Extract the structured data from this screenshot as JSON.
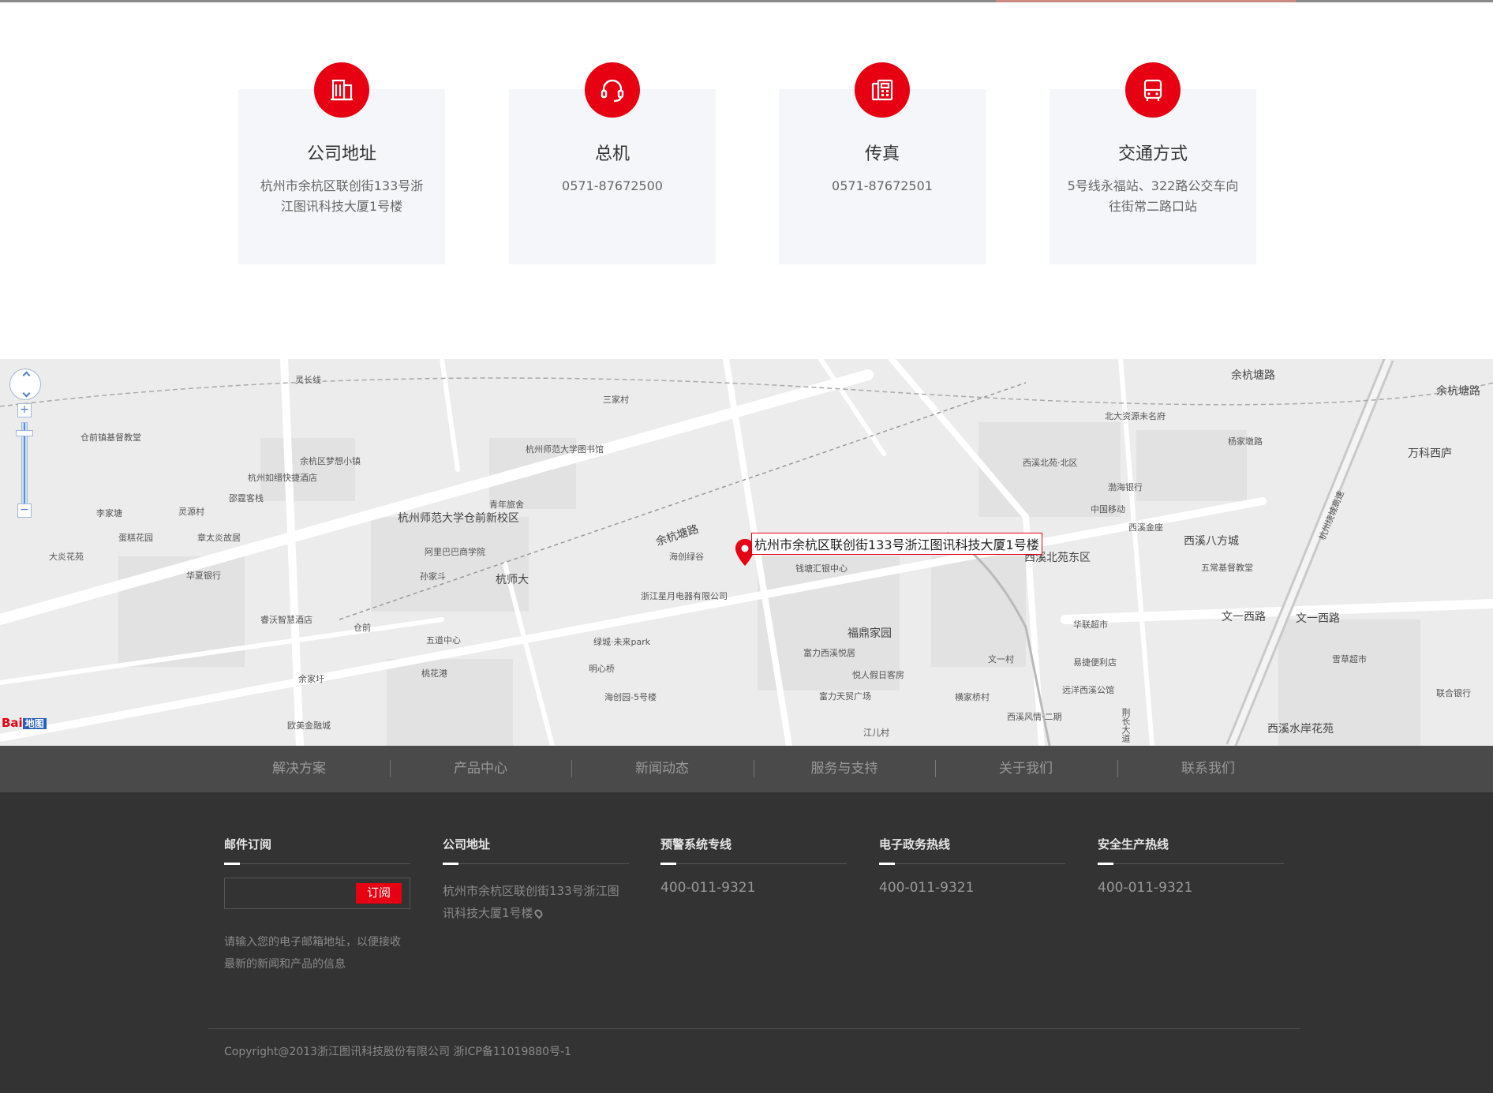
{
  "contact_cards": [
    {
      "title": "公司地址",
      "text": "杭州市余杭区联创街133号浙江图讯科技大厦1号楼",
      "icon": "building-icon"
    },
    {
      "title": "总机",
      "text": "0571-87672500",
      "icon": "headset-icon"
    },
    {
      "title": "传真",
      "text": "0571-87672501",
      "icon": "fax-icon"
    },
    {
      "title": "交通方式",
      "text": "5号线永福站、322路公交车向往街常二路口站",
      "icon": "bus-icon"
    }
  ],
  "map": {
    "info_label": "杭州市余杭区联创街133号浙江图讯科技大厦1号楼",
    "zoom_in": "+",
    "zoom_out": "−",
    "logo_text": "Bai",
    "logo_sub": "地图",
    "labels": [
      "灵长线",
      "三家村",
      "仓前镇基督教堂",
      "杭州师范大学图书馆",
      "余杭区梦想小镇",
      "杭州如缙快捷酒店",
      "邵霆客栈",
      "青年旅舍",
      "杭州师范大学仓前新校区",
      "余杭塘路",
      "余杭塘路",
      "李家塘",
      "灵源村",
      "蛋糕花园",
      "章太炎故居",
      "大炎花苑",
      "阿里巴巴商学院",
      "海创绿谷",
      "钱塘汇银中心",
      "孙家斗",
      "杭师大",
      "华夏银行",
      "浙江星月电器有限公司",
      "睿沃智慧酒店",
      "仓前",
      "五道中心",
      "绿城·未来park",
      "福鼎家园",
      "余家圩",
      "桃花港",
      "明心桥",
      "富力西溪悦居",
      "悦人假日客房",
      "富力天贸广场",
      "海创园-5号楼",
      "欧美金融城",
      "西溪北苑东区",
      "西溪八方城",
      "西溪北苑·北区",
      "渤海银行",
      "中国移动",
      "西溪金座",
      "华联超市",
      "易捷便利店",
      "远洋西溪公馆",
      "西溪风情·二期",
      "荆长大道",
      "文一西路",
      "文一西路",
      "余杭塘路",
      "北大资源未名府",
      "杨家墩路",
      "万科西庐",
      "西溪水岸花苑",
      "杭州绕城高速",
      "联合银行",
      "五常基督教堂",
      "江儿村",
      "横家桥村",
      "文一村",
      "雪草超市"
    ]
  },
  "nav": [
    "解决方案",
    "产品中心",
    "新闻动态",
    "服务与支持",
    "关于我们",
    "联系我们"
  ],
  "footer": {
    "subscribe": {
      "title": "邮件订阅",
      "button": "订阅",
      "note": "请输入您的电子邮箱地址，以便接收最新的新闻和产品的信息",
      "placeholder": ""
    },
    "address": {
      "title": "公司地址",
      "text": "杭州市余杭区联创街133号浙江图讯科技大厦1号楼"
    },
    "warning": {
      "title": "预警系统专线",
      "phone": "400-011-9321"
    },
    "egov": {
      "title": "电子政务热线",
      "phone": "400-011-9321"
    },
    "safety": {
      "title": "安全生产热线",
      "phone": "400-011-9321"
    },
    "copyright": "Copyright@2013浙江图讯科技股份有限公司 浙ICP备11019880号-1"
  },
  "colors": {
    "accent": "#e60012",
    "nav_bg": "#4a4a4a",
    "footer_bg": "#333333",
    "card_bg": "#f5f6f9"
  }
}
